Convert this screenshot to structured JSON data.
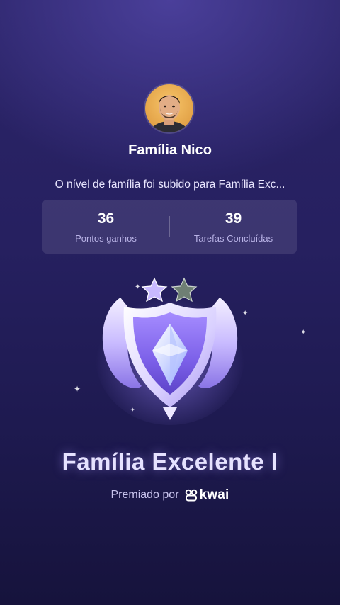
{
  "family": {
    "name": "Família Nico",
    "message": "O nível de família foi subido para Família Exc..."
  },
  "stats": [
    {
      "value": "36",
      "label": "Pontos ganhos"
    },
    {
      "value": "39",
      "label": "Tarefas Concluídas"
    }
  ],
  "badge": {
    "icon": "shield-diamond-icon",
    "stars_earned": 1,
    "stars_total": 2
  },
  "level": {
    "title": "Família Excelente I"
  },
  "awarded": {
    "label": "Premiado por",
    "brand": "kwai"
  },
  "colors": {
    "background": "#262060",
    "accent": "#b7a6ff",
    "card": "rgba(255,255,255,0.10)"
  }
}
